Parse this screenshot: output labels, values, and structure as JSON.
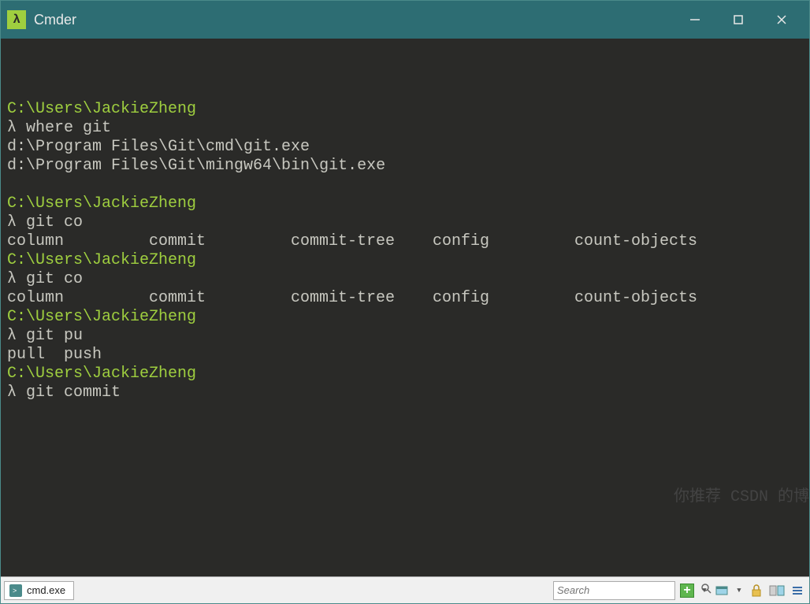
{
  "window": {
    "title": "Cmder",
    "icon_glyph": "λ"
  },
  "terminal": {
    "lines": [
      {
        "type": "blank"
      },
      {
        "type": "path",
        "text": "C:\\Users\\JackieZheng"
      },
      {
        "type": "cmd",
        "lambda": "λ",
        "text": " where git"
      },
      {
        "type": "out",
        "text": "d:\\Program Files\\Git\\cmd\\git.exe"
      },
      {
        "type": "out",
        "text": "d:\\Program Files\\Git\\mingw64\\bin\\git.exe"
      },
      {
        "type": "blank"
      },
      {
        "type": "path",
        "text": "C:\\Users\\JackieZheng"
      },
      {
        "type": "cmd",
        "lambda": "λ",
        "text": " git co"
      },
      {
        "type": "completions",
        "items": [
          "column",
          "commit",
          "commit-tree",
          "config",
          "count-objects"
        ]
      },
      {
        "type": "path",
        "text": "C:\\Users\\JackieZheng"
      },
      {
        "type": "cmd",
        "lambda": "λ",
        "text": " git co"
      },
      {
        "type": "completions",
        "items": [
          "column",
          "commit",
          "commit-tree",
          "config",
          "count-objects"
        ]
      },
      {
        "type": "path",
        "text": "C:\\Users\\JackieZheng"
      },
      {
        "type": "cmd",
        "lambda": "λ",
        "text": " git pu"
      },
      {
        "type": "out",
        "text": "pull  push"
      },
      {
        "type": "path",
        "text": "C:\\Users\\JackieZheng"
      },
      {
        "type": "cmd",
        "lambda": "λ",
        "text": " git commit"
      }
    ]
  },
  "watermark": "你推荐 CSDN 的博",
  "statusbar": {
    "tab_label": "cmd.exe",
    "search_placeholder": "Search"
  }
}
